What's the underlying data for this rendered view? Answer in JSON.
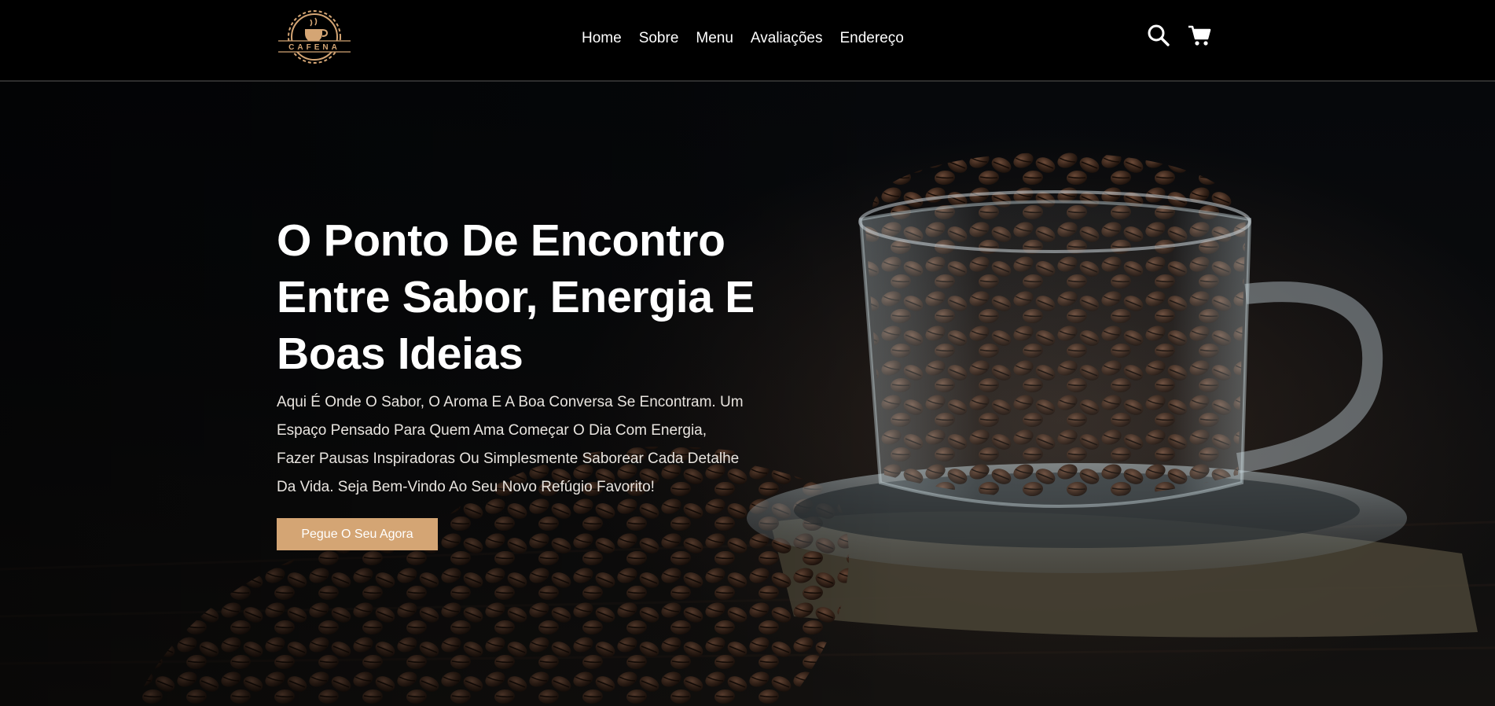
{
  "brand": {
    "logo_text": "CAFENA",
    "accent_color": "#d4a574"
  },
  "nav": {
    "items": [
      {
        "label": "Home"
      },
      {
        "label": "Sobre"
      },
      {
        "label": "Menu"
      },
      {
        "label": "Avaliações"
      },
      {
        "label": "Endereço"
      }
    ]
  },
  "header_icons": {
    "search": "search-icon",
    "cart": "cart-icon"
  },
  "hero": {
    "title_lines": [
      "O Ponto De Encontro",
      "Entre Sabor, Energia E",
      "Boas Ideias"
    ],
    "text": "Aqui É Onde O Sabor, O Aroma E A Boa Conversa Se Encontram. Um Espaço Pensado Para Quem Ama Começar O Dia Com Energia, Fazer Pausas Inspiradoras Ou Simplesmente Saborear Cada Detalhe Da Vida. Seja Bem-Vindo Ao Seu Novo Refúgio Favorito!",
    "cta_label": "Pegue O Seu Agora",
    "image": "coffee-beans-glass-cup"
  }
}
